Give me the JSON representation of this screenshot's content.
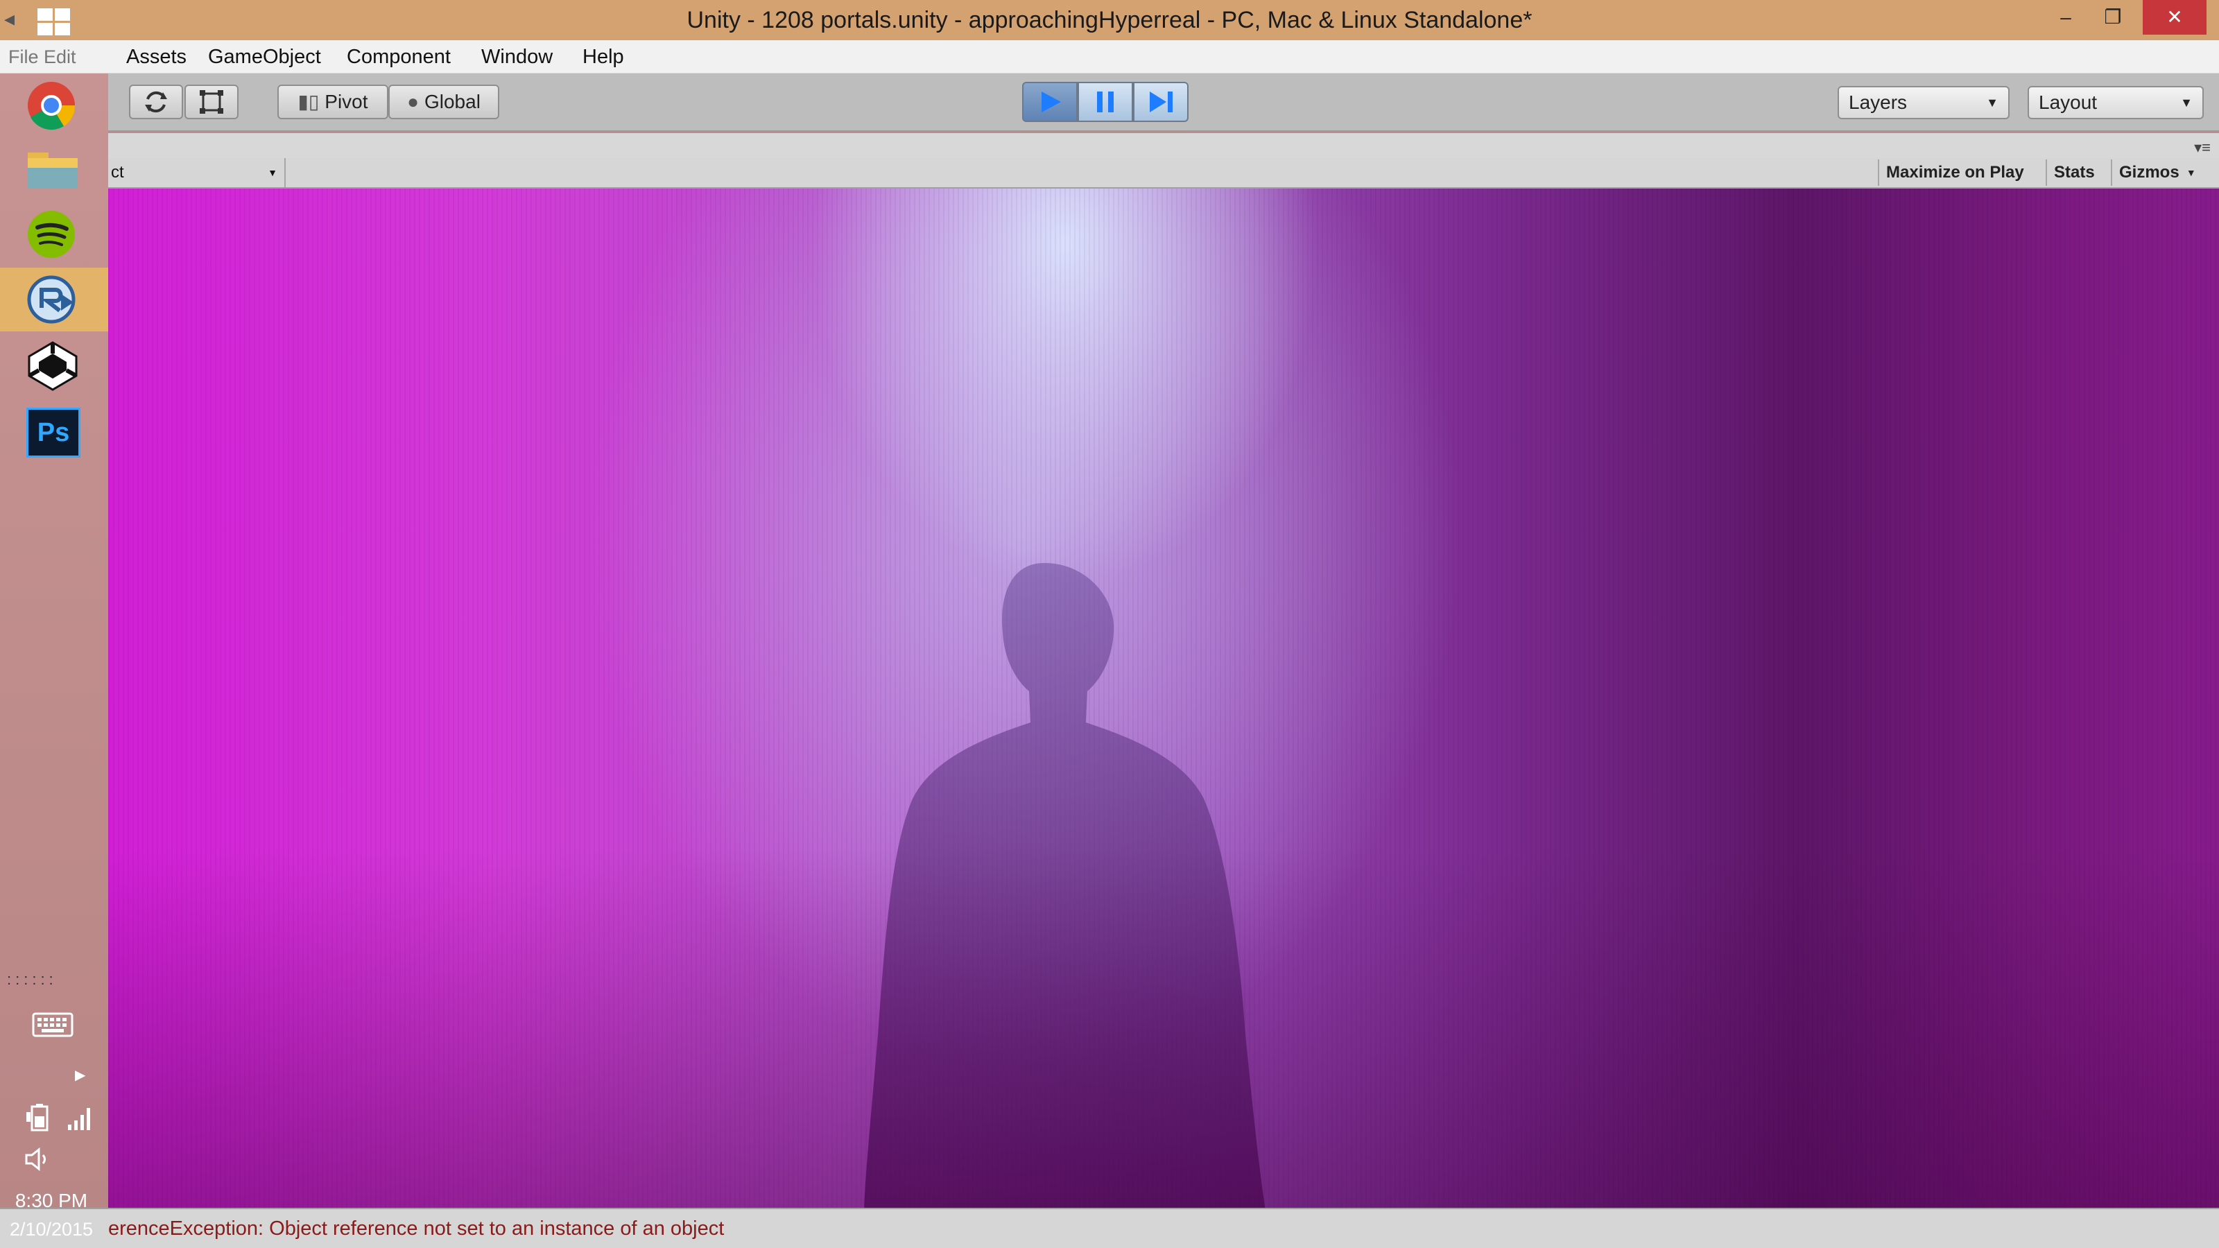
{
  "window": {
    "title": "Unity - 1208 portals.unity - approachingHyperreal - PC, Mac & Linux Standalone*",
    "controls": {
      "minimize": "–",
      "restore": "❐",
      "close": "✕"
    }
  },
  "menu": {
    "ghost_items": "File  Edit",
    "items": [
      "Assets",
      "GameObject",
      "Component",
      "Window",
      "Help"
    ]
  },
  "toolbar": {
    "pivot_label": "Pivot",
    "global_label": "Global",
    "layers_label": "Layers",
    "layout_label": "Layout"
  },
  "gameview": {
    "aspect_label": "ct",
    "maximize_label": "Maximize on Play",
    "stats_label": "Stats",
    "gizmos_label": "Gizmos"
  },
  "status": {
    "message": "erenceException: Object reference not set to an instance of an object"
  },
  "taskbar": {
    "apps": [
      "chrome",
      "file-explorer",
      "spotify",
      "remote-desktop",
      "unity",
      "photoshop"
    ],
    "photoshop_label": "Ps",
    "dots": "::::::",
    "time": "8:30 PM",
    "date": "2/10/2015"
  },
  "colors": {
    "title_bg": "#d4a271",
    "close_bg": "#c7363a",
    "sidebar_bg": "#c08a8a",
    "active_app": "#e3b36a",
    "error_text": "#8a1b1b",
    "scene_magenta": "#d21fd6"
  }
}
